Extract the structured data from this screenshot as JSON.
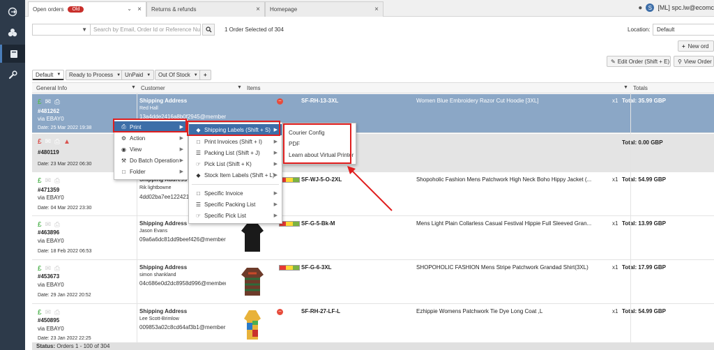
{
  "tabs": [
    {
      "label": "Open orders",
      "badge": "Old"
    },
    {
      "label": "Returns & refunds"
    },
    {
      "label": "Homepage"
    }
  ],
  "user": {
    "initial": "S",
    "name": "[ML] spc.lw@ecomc"
  },
  "toolbar": {
    "search_placeholder": "Search by Email, Order Id or Reference Numb",
    "selected_text": "1 Order Selected of 304",
    "location_label": "Location:",
    "location_value": "Default",
    "new_order": "New ord",
    "edit_order": "Edit Order (Shift + E)",
    "view_order": "View Order (S"
  },
  "filters": [
    "Default",
    "Ready to Process",
    "UnPaid",
    "Out Of Stock"
  ],
  "columns": {
    "general": "General Info",
    "customer": "Customer",
    "items": "Items",
    "totals": "Totals"
  },
  "orders": [
    {
      "id": "#481262",
      "via": "via EBAY0",
      "date": "Date: 25 Mar 2022 19:38",
      "ship": "Shipping Address",
      "name": "Red Hall",
      "email": "13a4dde2416a8b0f2945@members...",
      "sku": "SF-RH-13-3XL",
      "desc": "Women Blue Embroidery Razor Cut Hoodie [3XL]",
      "qty": "x1",
      "total": "Total: 35.99 GBP"
    },
    {
      "id": "#480119",
      "via": "",
      "date": "Date: 23 Mar 2022 06:30",
      "ship": "",
      "name": "",
      "email": "",
      "sku": "",
      "desc": "",
      "qty": "",
      "total": "Total: 0.00 GBP"
    },
    {
      "id": "#471359",
      "via": "via EBAY0",
      "date": "Date: 04 Mar 2022 23:30",
      "ship": "Shipping Address",
      "name": "Rik lightbowne",
      "email": "4dd02ba7ee1224214...",
      "sku": "SF-WJ-5-O-2XL",
      "desc": "Shopoholic Fashion Mens Patchwork High Neck Boho Hippy Jacket (...",
      "qty": "x1",
      "total": "Total: 54.99 GBP"
    },
    {
      "id": "#463896",
      "via": "via EBAY0",
      "date": "Date: 18 Feb 2022 06:53",
      "ship": "Shipping Address",
      "name": "Jason Evans",
      "email": "09a6a6dc81dd9beef426@members...",
      "sku": "SF-G-5-Bk-M",
      "desc": "Mens Light Plain Collarless Casual Festival Hippie Full Sleeved Gran...",
      "qty": "x1",
      "total": "Total: 13.99 GBP"
    },
    {
      "id": "#453673",
      "via": "via EBAY0",
      "date": "Date: 29 Jan 2022 20:52",
      "ship": "Shipping Address",
      "name": "simon shankland",
      "email": "04c686e0d2dc8958d996@members...",
      "sku": "SF-G-6-3XL",
      "desc": "SHOPOHOLIC FASHION Mens Stripe Patchwork Grandad Shirt(3XL)",
      "qty": "x1",
      "total": "Total: 17.99 GBP"
    },
    {
      "id": "#450895",
      "via": "via EBAY0",
      "date": "Date: 23 Jan 2022 22:25",
      "ship": "Shipping Address",
      "name": "Lee Scott-Brimlow",
      "email": "009853a02c8cd64af3b1@members...",
      "sku": "SF-RH-27-LF-L",
      "desc": "Ezhippie Womens Patchwork Tie Dye Long Coat ,L",
      "qty": "x1",
      "total": "Total: 54.99 GBP"
    }
  ],
  "context_menu": [
    "Print",
    "Action",
    "View",
    "Do Batch Operation",
    "Folder"
  ],
  "print_menu": [
    "Shipping Labels (Shift + S)",
    "Print Invoices (Shift + I)",
    "Packing List (Shift + J)",
    "Pick List (Shift + K)",
    "Stock Item Labels (Shift + L)",
    "Specific Invoice",
    "Specific Packing List",
    "Specific Pick List"
  ],
  "shipping_menu": [
    "Courier Config",
    "PDF",
    "Learn about Virtual Printer"
  ],
  "status": {
    "label": "Status:",
    "text": "Orders 1 - 100 of 304"
  },
  "colors": {
    "sidebar": "#2d3a4a",
    "selected_row": "#8ba7c6",
    "highlight": "#3d6ea8",
    "annotation": "#e01e1e"
  }
}
